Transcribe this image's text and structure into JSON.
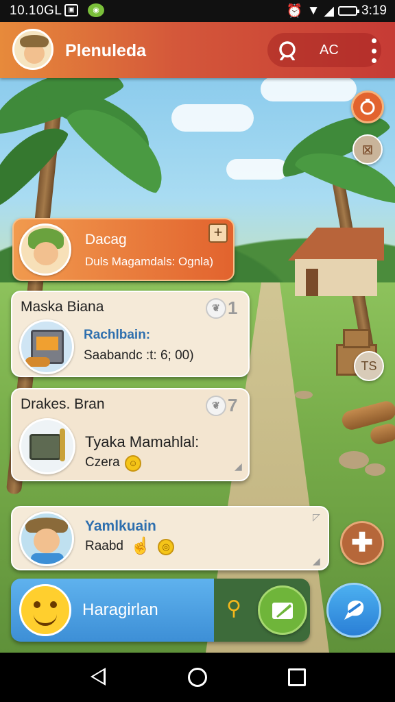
{
  "status_bar": {
    "time": "10.10GL",
    "clock": "3:19"
  },
  "header": {
    "title": "Plenuleda",
    "action_label": "AC"
  },
  "cards": [
    {
      "title": "Dacag",
      "subtitle": "Duls Magamdals: Ognla)",
      "badge_symbol": "+"
    },
    {
      "title": "Maska Biana",
      "detail_title": "Rachlbain:",
      "detail_text": "Saabandc :t: 6; 00)",
      "badge_count": "1"
    },
    {
      "title": "Drakes. Bran",
      "detail_title": "Tyaka Mamahlal:",
      "detail_text": "Czera",
      "badge_count": "7"
    },
    {
      "title": "Yamlkuain",
      "detail_text": "Raabd"
    }
  ],
  "bottom_bar": {
    "label": "Haragirlan"
  },
  "side_buttons": {
    "signpost_glyph": "TS"
  },
  "colors": {
    "header_start": "#e78a3b",
    "header_end": "#c63b35",
    "accent_orange": "#e2632e",
    "accent_blue": "#3d8fd6",
    "accent_green": "#6fb53a",
    "card_bg": "#f5ead8"
  }
}
